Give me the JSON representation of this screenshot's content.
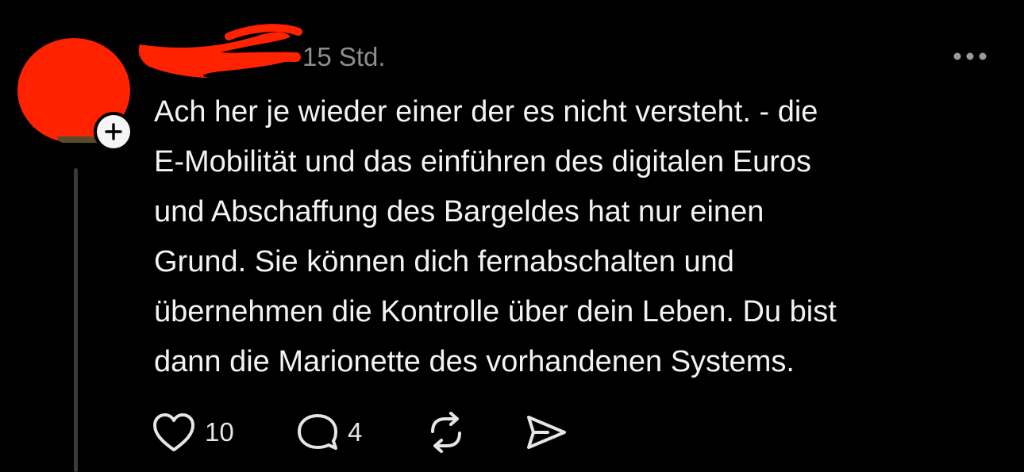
{
  "post": {
    "timestamp": "15 Std.",
    "text": "Ach her je wieder einer der es nicht versteht. - die\nE-Mobilität und das einführen des digitalen Euros\nund Abschaffung des Bargeldes hat nur einen\nGrund. Sie können dich fernabschalten und\nübernehmen die Kontrolle über dein Leben. Du bist\ndann die Marionette des vorhandenen Systems.",
    "likes": "10",
    "replies": "4",
    "avatar_color": "#ff2200",
    "redaction_color": "#ff2200"
  },
  "icons": {
    "more": "more-horizontal-icon",
    "follow": "plus-icon",
    "like": "heart-icon",
    "reply": "comment-icon",
    "repost": "repost-icon",
    "share": "send-icon"
  }
}
